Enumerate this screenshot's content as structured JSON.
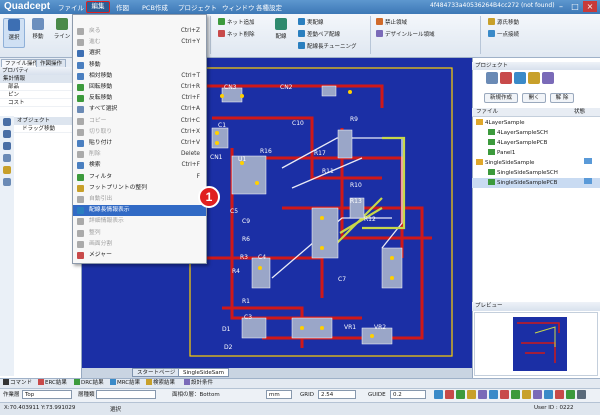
{
  "app": {
    "logo": "Quadcept",
    "doc_title": "4f484733a40536264B4cc272 (not found)"
  },
  "menubar": {
    "file": "ファイル",
    "edit": "編集",
    "view": "作図",
    "pcb": "PCB作成",
    "project": "プロジェクト",
    "window": "ウィンドウ",
    "help": "各種設定"
  },
  "ribbon": {
    "select": "選択",
    "move": "移動",
    "line": "ライン",
    "net_add": "ネット追加",
    "net_delete": "ネット削除",
    "route": "配線",
    "real_route": "実配線",
    "diffpair_route": "差動ペア配線",
    "length_tune": "配線長チューニング",
    "keepout": "禁止領域",
    "design_rule": "デザインルール領域",
    "source_route": "源氏移動",
    "one_touch": "一点接続"
  },
  "left_panel": {
    "tab1": "ファイル操作",
    "tab2": "作図操作",
    "header": "プロパティ",
    "group1": "集計情報",
    "rows": [
      "部品",
      "ピン",
      "コスト"
    ],
    "group2": "オブジェクト",
    "row2": "ドラッグ移動"
  },
  "edit_menu": {
    "items": [
      {
        "label": "戻る",
        "shortcut": "Ctrl+Z"
      },
      {
        "label": "進む",
        "shortcut": "Ctrl+Y"
      },
      {
        "label": "選択",
        "shortcut": ""
      },
      {
        "label": "移動",
        "shortcut": ""
      },
      {
        "label": "相対移動",
        "shortcut": "Ctrl+T"
      },
      {
        "label": "回転移動",
        "shortcut": "Ctrl+R"
      },
      {
        "label": "反転移動",
        "shortcut": "Ctrl+F"
      },
      {
        "label": "すべて選択",
        "shortcut": "Ctrl+A"
      },
      {
        "label": "コピー",
        "shortcut": "Ctrl+C"
      },
      {
        "label": "切り取り",
        "shortcut": "Ctrl+X"
      },
      {
        "label": "貼り付け",
        "shortcut": "Ctrl+V"
      },
      {
        "label": "削除",
        "shortcut": "Delete"
      },
      {
        "label": "検索",
        "shortcut": "Ctrl+F"
      },
      {
        "label": "フィルタ",
        "shortcut": "F"
      },
      {
        "label": "フットプリントの整列",
        "shortcut": ""
      },
      {
        "label": "自動引出",
        "shortcut": ""
      },
      {
        "label": "配線長情報表示",
        "shortcut": ""
      },
      {
        "label": "詳細情報表示",
        "shortcut": ""
      },
      {
        "label": "整列",
        "shortcut": ""
      },
      {
        "label": "画面分割",
        "shortcut": ""
      },
      {
        "label": "メジャー",
        "shortcut": ""
      }
    ],
    "highlighted": "配線長情報表示"
  },
  "callout": "1",
  "project_panel": {
    "header": "プロジェクト",
    "new_button": "新規作成",
    "open_button": "開く",
    "close_button": "解 除",
    "col_file": "ファイル",
    "col_status": "状態",
    "tree": [
      {
        "label": "4LayerSample",
        "indent": 0
      },
      {
        "label": "4LayerSampleSCH",
        "indent": 2
      },
      {
        "label": "4LayerSamplePCB",
        "indent": 2
      },
      {
        "label": "Panel1",
        "indent": 2
      },
      {
        "label": "SingleSideSample",
        "indent": 0
      },
      {
        "label": "SingleSideSampleSCH",
        "indent": 2
      },
      {
        "label": "SingleSideSamplePCB",
        "indent": 2
      }
    ],
    "preview": "プレビュー"
  },
  "doc_tabs": {
    "start": "スタートページ",
    "pcb": "SingleSideSam"
  },
  "bottom_tabs": [
    "コマンド",
    "ERC結果",
    "DRC結果",
    "MRC結果",
    "検索結果",
    "設計条件"
  ],
  "toolbar2": {
    "work_layer_label": "作業層",
    "work_layer": "Top",
    "layer_class_label": "層種類",
    "display_label": "面相の層：Bottom",
    "unit": "mm",
    "grid_label": "GRID",
    "grid_value": "2.54",
    "guide_label": "GUIDE",
    "guide_value": "0.2"
  },
  "status": {
    "coords": "X:70.403911  Y:73.991029",
    "mode": "選択",
    "user": "User ID : 0222"
  },
  "pcb_labels": [
    "CN3",
    "CN2",
    "C1",
    "CN1",
    "R9",
    "C10",
    "R16",
    "R17",
    "U1",
    "R11",
    "R10",
    "R13",
    "R12",
    "C5",
    "C9",
    "R6",
    "R4",
    "R3",
    "C4",
    "C7",
    "R1",
    "C3",
    "D1",
    "D2",
    "VR1",
    "VR2"
  ]
}
